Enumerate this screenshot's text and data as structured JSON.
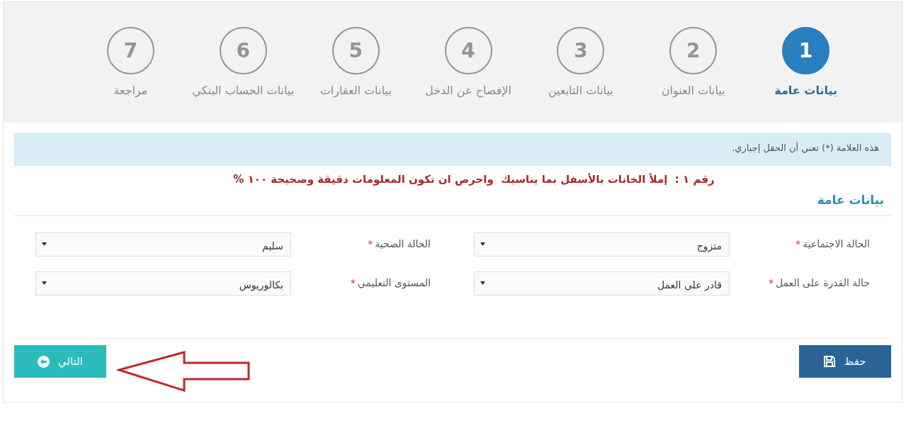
{
  "steps": [
    {
      "number": "1",
      "label": "بيانات عامة",
      "selected": true
    },
    {
      "number": "2",
      "label": "بيانات العنوان",
      "selected": false
    },
    {
      "number": "3",
      "label": "بيانات التابعين",
      "selected": false
    },
    {
      "number": "4",
      "label": "الإفصاح عن الدخل",
      "selected": false
    },
    {
      "number": "5",
      "label": "بيانات العقارات",
      "selected": false
    },
    {
      "number": "6",
      "label": "بيانات الحساب البنكي",
      "selected": false
    },
    {
      "number": "7",
      "label": "مراجعة",
      "selected": false
    }
  ],
  "notice": "هذه العلامة (*) تعني أن الحقل إجباري.",
  "instruction": "رقم ١ :  إملأ الخانات بالأسفل بما يناسبك  واحرص ان تكون المعلومات دقيقة وصحيحة ١٠٠ %",
  "section_title": "بيانات عامة",
  "fields": [
    {
      "label": "الحالة الاجتماعية",
      "required_mark": "*",
      "value": "متزوج"
    },
    {
      "label": "الحالة الصحية",
      "required_mark": "*",
      "value": "سليم"
    },
    {
      "label": "حالة القدرة على العمل",
      "required_mark": "*",
      "value": "قادر على العمل"
    },
    {
      "label": "المستوى التعليمي",
      "required_mark": "*",
      "value": "بكالوريوس"
    }
  ],
  "buttons": [
    {
      "kind": "save",
      "label": "حفظ"
    },
    {
      "kind": "next",
      "label": "التالي"
    }
  ],
  "annotation": {
    "kind": "arrow"
  }
}
